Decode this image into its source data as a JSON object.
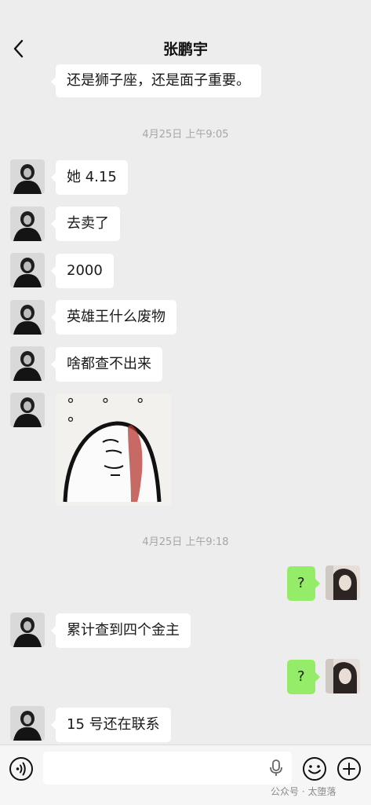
{
  "header": {
    "title": "张鹏宇"
  },
  "messages": {
    "partial_top": "还是狮子座，还是面子重要。",
    "ts1": "4月25日 上午9:05",
    "m1": "她 4.15",
    "m2": "去卖了",
    "m3": "2000",
    "m4": "英雄王什么废物",
    "m5": "啥都查不出来",
    "sticker_dots": "° ° ° °",
    "ts2": "4月25日 上午9:18",
    "me1": "?",
    "m6": "累计查到四个金主",
    "me2": "?",
    "m7": "15 号还在联系"
  },
  "bottombar": {
    "watermark": "公众号 · 太堕落"
  },
  "colors": {
    "bg": "#ededed",
    "self_bubble": "#95ec69",
    "other_bubble": "#ffffff"
  },
  "icons": [
    "back-arrow-icon",
    "voice-icon",
    "mic-icon",
    "emoji-icon",
    "plus-icon"
  ]
}
